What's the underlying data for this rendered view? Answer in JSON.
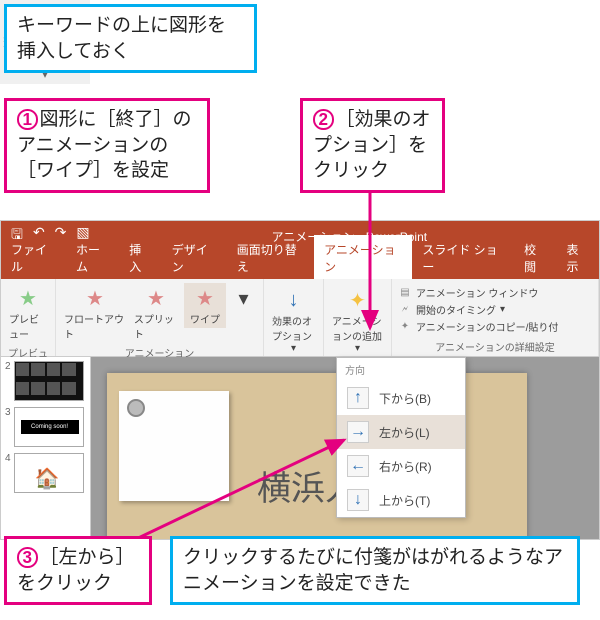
{
  "callouts": {
    "top": "キーワードの上に図形を挿入しておく",
    "c1": {
      "num": "1",
      "text": "図形に［終了］のアニメーションの［ワイプ］を設定"
    },
    "c2": {
      "num": "2",
      "text": "［効果のオプション］をクリック"
    },
    "c3": {
      "num": "3",
      "text": "［左から］をクリック"
    },
    "c4": "クリックするたびに付箋がはがれるようなアニメーションを設定できた"
  },
  "effect_option_button": {
    "label": "効果のオプション"
  },
  "ppt": {
    "title": "アニメーション - PowerPoint",
    "tabs": [
      "ファイル",
      "ホーム",
      "挿入",
      "デザイン",
      "画面切り替え",
      "アニメーション",
      "スライド ショー",
      "校閲",
      "表示"
    ],
    "active_tab_index": 5,
    "ribbon": {
      "preview": {
        "label": "プレビュー",
        "btn": "プレビュー"
      },
      "gallery": {
        "label": "アニメーション",
        "items": [
          "フロートアウト",
          "スプリット",
          "ワイプ"
        ],
        "selected_index": 2
      },
      "effect_options": "効果のオプション",
      "add_animation": "アニメーションの追加",
      "advanced": {
        "label": "アニメーションの詳細設定",
        "pane": "アニメーション ウィンドウ",
        "trigger": "開始のタイミング",
        "painter": "アニメーションのコピー/貼り付"
      }
    },
    "dropdown": {
      "header": "方向",
      "items": [
        {
          "arrow": "↑",
          "label": "下から(B)"
        },
        {
          "arrow": "→",
          "label": "左から(L)"
        },
        {
          "arrow": "←",
          "label": "右から(R)"
        },
        {
          "arrow": "↓",
          "label": "上から(T)"
        }
      ],
      "selected_index": 1
    },
    "thumbs": {
      "s2": {
        "num": "2"
      },
      "s3": {
        "num": "3",
        "text": "Coming soon!"
      },
      "s4": {
        "num": "4",
        "icon": "🏠"
      }
    },
    "slide_headline": "横浜人気駅弁"
  }
}
